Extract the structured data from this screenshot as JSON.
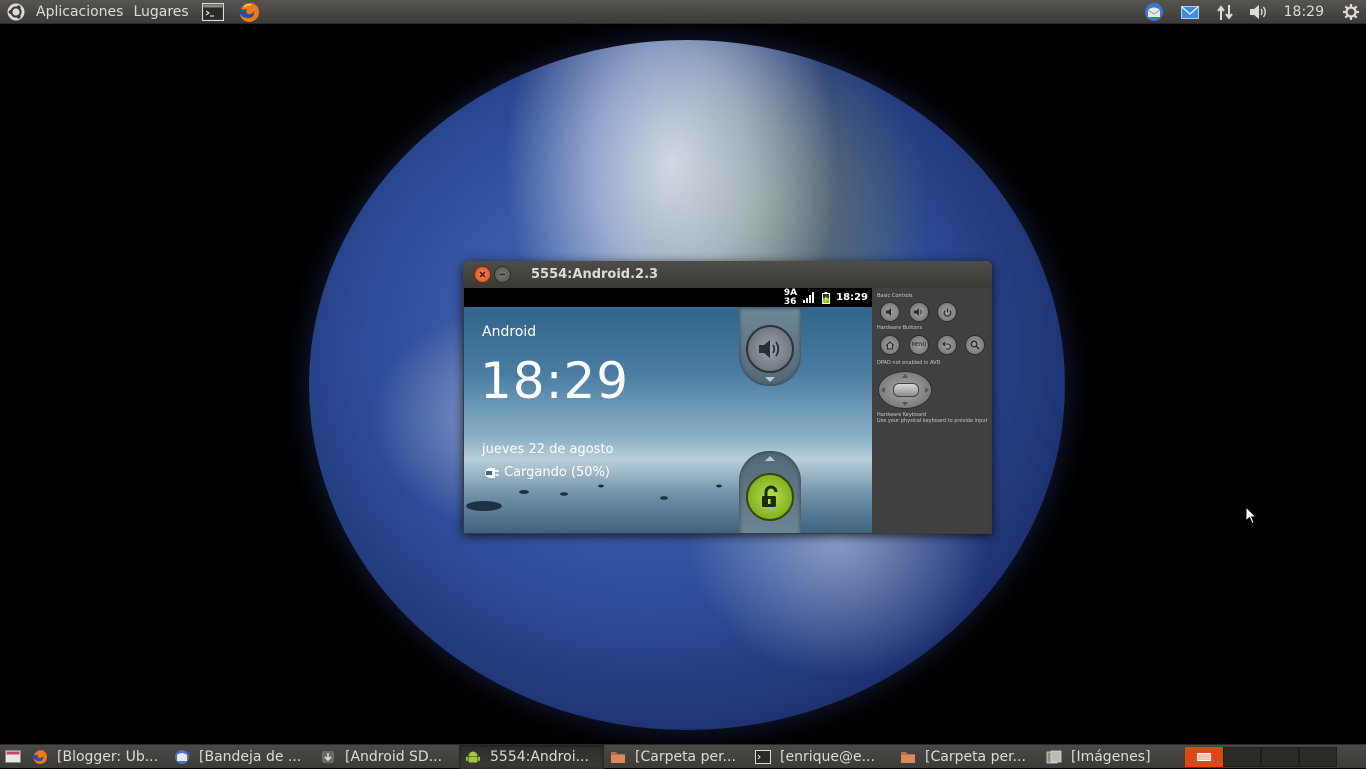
{
  "top_panel": {
    "menu_applications": "Aplicaciones",
    "menu_places": "Lugares",
    "launchers": [
      "terminal-icon",
      "firefox-icon"
    ],
    "tray_icons": [
      "thunderbird-icon",
      "mail-icon",
      "network-icon",
      "volume-icon",
      "gear-icon"
    ],
    "clock": "18:29"
  },
  "emulator_window": {
    "title": "5554:Android.2.3",
    "android": {
      "status_carrier_top": "9A",
      "status_carrier_bottom": "36",
      "status_time": "18:29",
      "label": "Android",
      "clock": "18:29",
      "date": "jueves 22 de agosto",
      "charging": "Cargando (50%)"
    },
    "controls": {
      "basic_controls_label": "Basic Controls",
      "hardware_buttons_label": "Hardware Buttons",
      "menu_button": "MENU",
      "dpad_label": "DPAD not enabled in AVD",
      "keyboard_label": "Hardware Keyboard",
      "keyboard_hint": "Use your physical keyboard to provide input"
    }
  },
  "taskbar": {
    "tasks": [
      {
        "label": "[Blogger: Ub...",
        "icon": "firefox-icon",
        "active": false
      },
      {
        "label": "[Bandeja de ...",
        "icon": "thunderbird-icon",
        "active": false
      },
      {
        "label": "[Android SD...",
        "icon": "download-icon",
        "active": false
      },
      {
        "label": "5554:Androi...",
        "icon": "android-icon",
        "active": true
      },
      {
        "label": "[Carpeta per...",
        "icon": "folder-icon",
        "active": false
      },
      {
        "label": "[enrique@e...",
        "icon": "terminal-icon",
        "active": false
      },
      {
        "label": "[Carpeta per...",
        "icon": "folder-icon",
        "active": false
      },
      {
        "label": "[Imágenes]",
        "icon": "file-manager-icon",
        "active": false
      }
    ]
  },
  "colors": {
    "panel": "#3c3b37",
    "accent": "#dd4814",
    "text": "#dfdbd2"
  }
}
